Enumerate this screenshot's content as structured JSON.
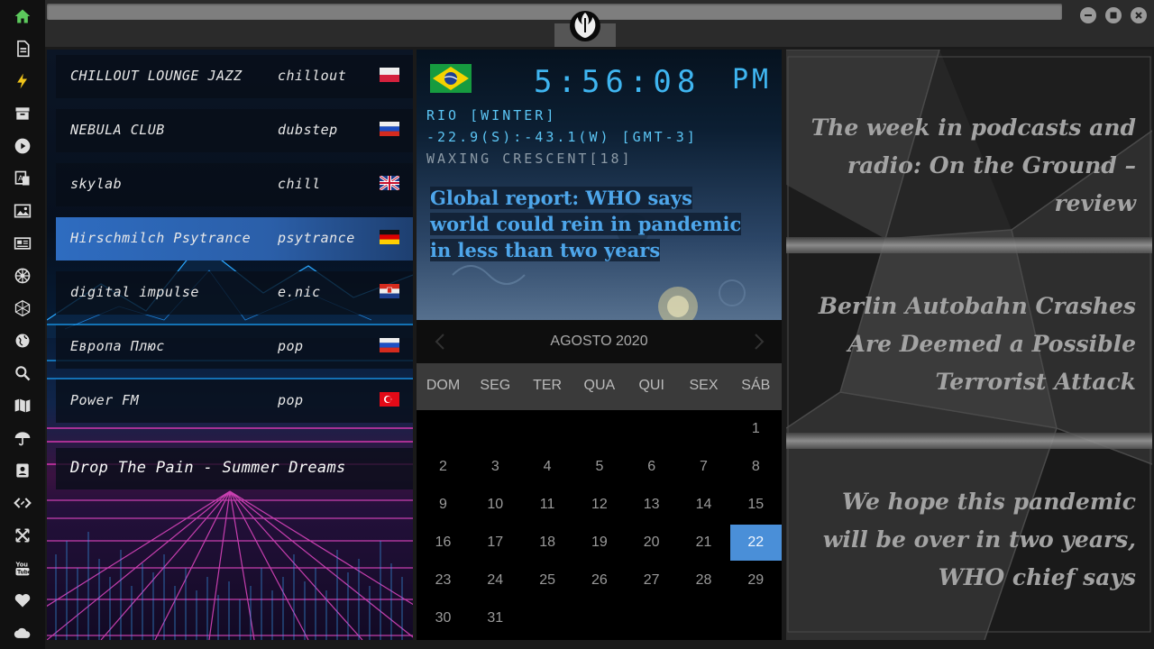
{
  "app": {
    "window_controls": [
      "minimize",
      "maximize",
      "close"
    ]
  },
  "sidebar": {
    "items": [
      {
        "icon": "home-icon",
        "color": "#5cc85c"
      },
      {
        "icon": "document-icon"
      },
      {
        "icon": "lightning-icon",
        "color": "#f0c419"
      },
      {
        "icon": "archive-icon"
      },
      {
        "icon": "play-icon"
      },
      {
        "icon": "translate-icon"
      },
      {
        "icon": "image-icon"
      },
      {
        "icon": "newspaper-icon"
      },
      {
        "icon": "empire-icon"
      },
      {
        "icon": "hexagon-icon"
      },
      {
        "icon": "globe-icon"
      },
      {
        "icon": "search-icon"
      },
      {
        "icon": "map-icon"
      },
      {
        "icon": "umbrella-icon"
      },
      {
        "icon": "contacts-icon"
      },
      {
        "icon": "code-icon"
      },
      {
        "icon": "crosshair-icon"
      },
      {
        "icon": "youtube-icon"
      },
      {
        "icon": "heart-icon"
      },
      {
        "icon": "cloud-icon"
      }
    ]
  },
  "radio": {
    "stations": [
      {
        "name": "CHILLOUT LOUNGE JAZZ",
        "genre": "chillout",
        "flag": "poland"
      },
      {
        "name": "NEBULA CLUB",
        "genre": "dubstep",
        "flag": "russia"
      },
      {
        "name": "skylab",
        "genre": "chill",
        "flag": "uk"
      },
      {
        "name": "Hirschmilch Psytrance",
        "genre": "psytrance",
        "flag": "germany",
        "active": true
      },
      {
        "name": "digital impulse",
        "genre": "e.nic",
        "flag": "croatia"
      },
      {
        "name": "Европа Плюс",
        "genre": "pop",
        "flag": "russia"
      },
      {
        "name": "Power FM",
        "genre": "pop",
        "flag": "turkey"
      }
    ],
    "now_playing": "Drop The Pain - Summer Dreams"
  },
  "clock": {
    "flag": "brazil",
    "time": "5:56:08",
    "ampm": "PM",
    "location": "RIO [WINTER]",
    "coords": "-22.9(S):-43.1(W) [GMT-3]",
    "moon": "WAXING CRESCENT[18]",
    "headline": "Global report: WHO says world could rein in pandemic in less than two years",
    "accent_color": "#3fb5f0"
  },
  "calendar": {
    "title": "AGOSTO 2020",
    "day_names": [
      "DOM",
      "SEG",
      "TER",
      "QUA",
      "QUI",
      "SEX",
      "SÁB"
    ],
    "first_weekday": 6,
    "days_in_month": 31,
    "today": 22,
    "today_color": "#4a8fd8"
  },
  "news": {
    "items": [
      "The week in podcasts and radio: On the Ground – review",
      "Berlin Autobahn Crashes Are Deemed a Possible Terrorist Attack",
      "We hope this pandemic will be over in two years, WHO chief says"
    ]
  }
}
